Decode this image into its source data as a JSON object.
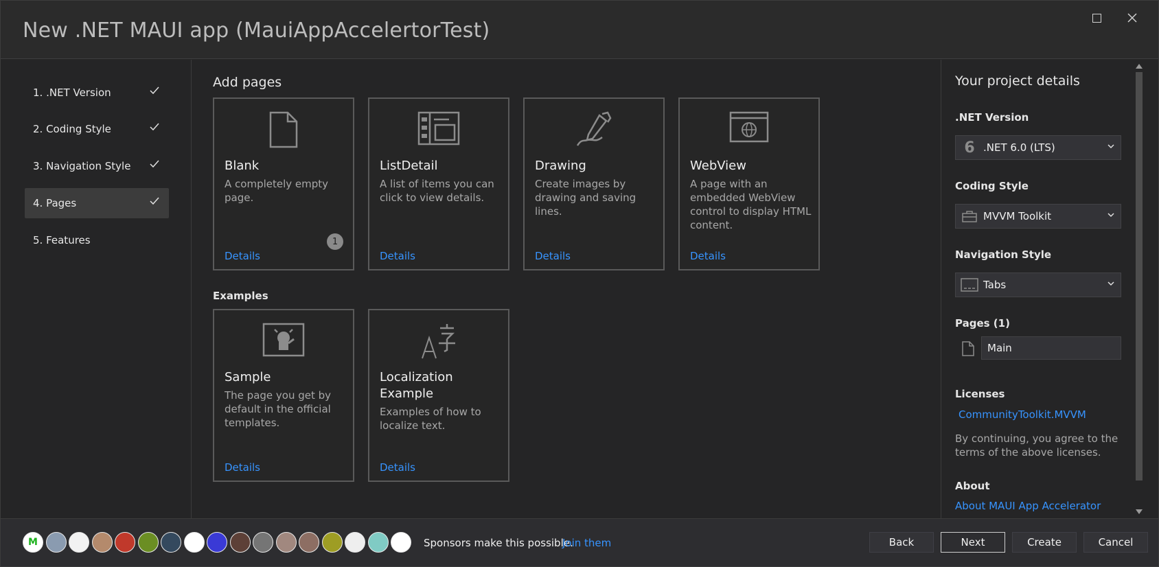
{
  "window": {
    "title": "New .NET MAUI app (MauiAppAccelertorTest)",
    "maximize_icon": "maximize-icon",
    "close_icon": "close-icon"
  },
  "steps": [
    {
      "label": "1. .NET Version",
      "done": true
    },
    {
      "label": "2. Coding Style",
      "done": true
    },
    {
      "label": "3. Navigation Style",
      "done": true
    },
    {
      "label": "4. Pages",
      "done": true,
      "active": true
    },
    {
      "label": "5. Features",
      "done": false
    }
  ],
  "main": {
    "add_pages_title": "Add pages",
    "examples_title": "Examples",
    "pages": [
      {
        "icon": "blank-page-icon",
        "title": "Blank",
        "desc": "A completely empty page.",
        "details": "Details",
        "badge": "1"
      },
      {
        "icon": "list-detail-icon",
        "title": "ListDetail",
        "desc": "A list of items you can click to view details.",
        "details": "Details"
      },
      {
        "icon": "drawing-pen-icon",
        "title": "Drawing",
        "desc": "Create images by drawing and saving lines.",
        "details": "Details"
      },
      {
        "icon": "webview-globe-icon",
        "title": "WebView",
        "desc": "A page with an embedded WebView control to display HTML content.",
        "details": "Details"
      }
    ],
    "examples": [
      {
        "icon": "sample-bot-icon",
        "title": "Sample",
        "desc": "The page you get by default in the official templates.",
        "details": "Details"
      },
      {
        "icon": "localization-icon",
        "title": "Localization Example",
        "desc": "Examples of how to localize text.",
        "details": "Details"
      }
    ]
  },
  "details_panel": {
    "title": "Your project details",
    "net_version": {
      "label": ".NET Version",
      "icon_glyph": "6",
      "value": ".NET 6.0 (LTS)"
    },
    "coding_style": {
      "label": "Coding Style",
      "icon": "toolbox-icon",
      "value": "MVVM Toolkit"
    },
    "navigation_style": {
      "label": "Navigation Style",
      "icon": "tabs-icon",
      "value": "Tabs"
    },
    "pages": {
      "label": "Pages (1)",
      "items": [
        "Main"
      ]
    },
    "licenses": {
      "label": "Licenses",
      "link": "CommunityToolkit.MVVM",
      "text": "By continuing, you agree to the terms of the above licenses."
    },
    "about": {
      "label": "About",
      "link": "About MAUI App Accelerator"
    }
  },
  "footer": {
    "sponsor_text": "Sponsors make this possible.",
    "sponsor_link": "Join them",
    "avatars": [
      {
        "glyph": "M",
        "bg": "#ffffff",
        "fg": "#1db11d"
      },
      {
        "glyph": "",
        "bg": "#8a9bb0"
      },
      {
        "glyph": "",
        "bg": "#f2f2f2"
      },
      {
        "glyph": "",
        "bg": "#b48a6c"
      },
      {
        "glyph": "",
        "bg": "#c0392b"
      },
      {
        "glyph": "",
        "bg": "#6b8e23"
      },
      {
        "glyph": "",
        "bg": "#34495e"
      },
      {
        "glyph": "",
        "bg": "#ffffff"
      },
      {
        "glyph": "",
        "bg": "#3a3ad6"
      },
      {
        "glyph": "",
        "bg": "#5d4037"
      },
      {
        "glyph": "",
        "bg": "#757575"
      },
      {
        "glyph": "",
        "bg": "#a1887f"
      },
      {
        "glyph": "",
        "bg": "#8d6e63"
      },
      {
        "glyph": "",
        "bg": "#9e9d24"
      },
      {
        "glyph": "",
        "bg": "#eeeeee"
      },
      {
        "glyph": "",
        "bg": "#80cbc4"
      },
      {
        "glyph": "",
        "bg": "#ffffff"
      }
    ],
    "buttons": {
      "back": "Back",
      "next": "Next",
      "create": "Create",
      "cancel": "Cancel"
    }
  },
  "colors": {
    "accent_link": "#3794ff",
    "background": "#252526"
  }
}
